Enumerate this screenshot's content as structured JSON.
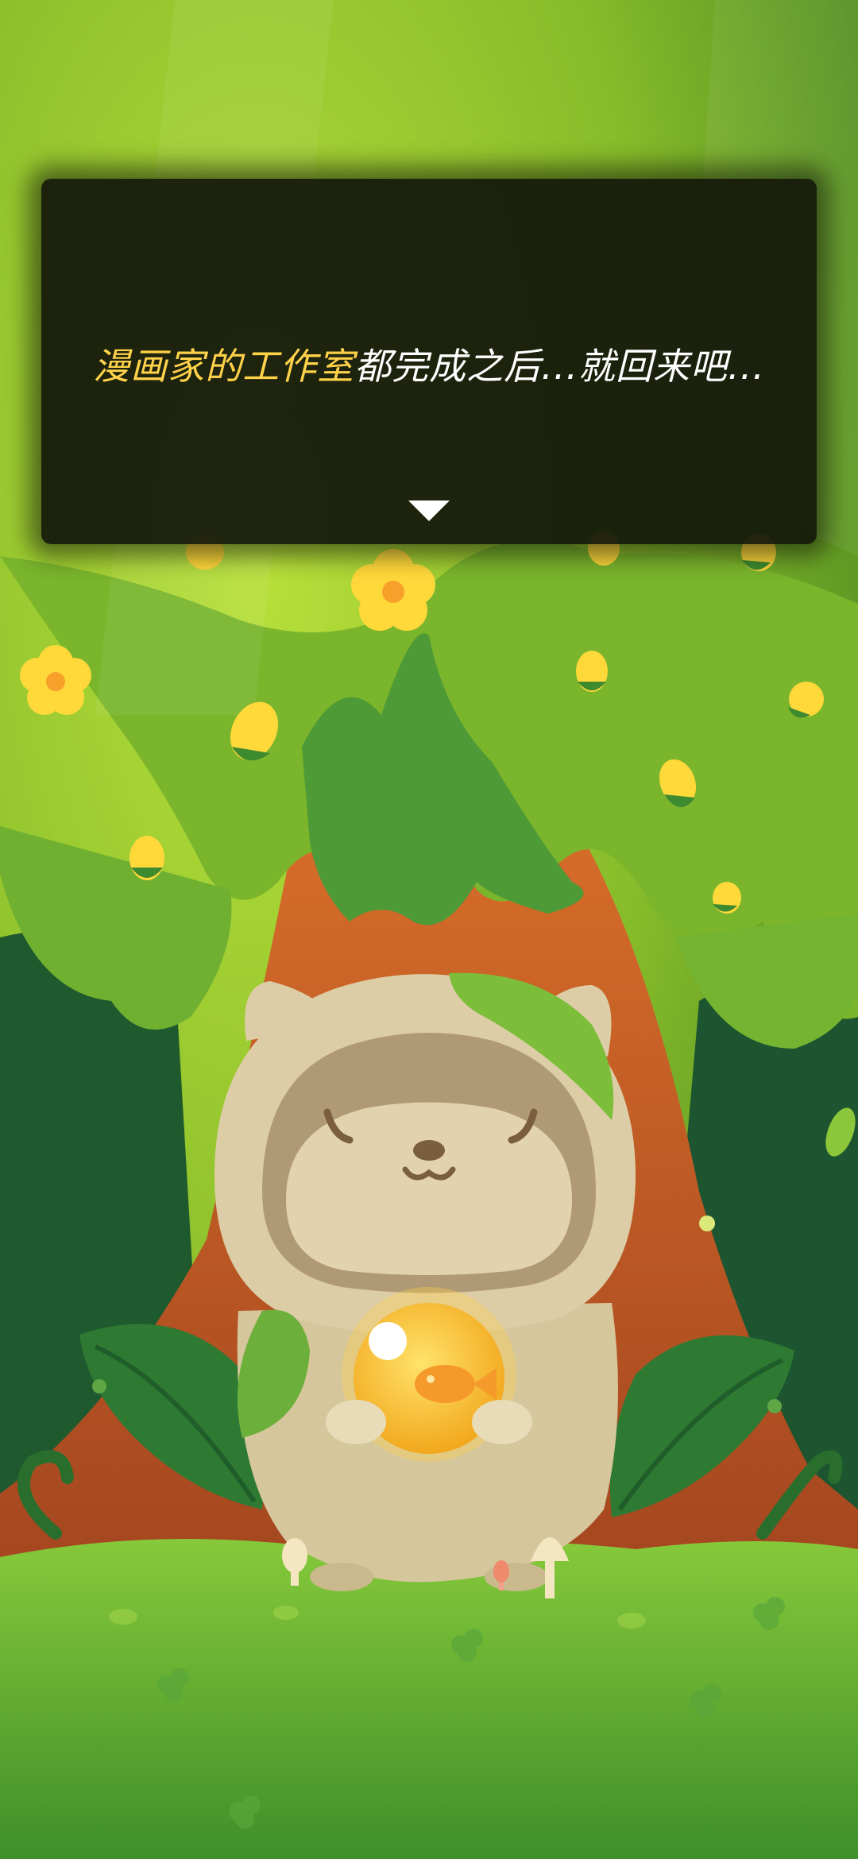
{
  "dialog": {
    "highlight_text": "漫画家的工作室",
    "body_text": "都完成之后...就回来吧...",
    "next_icon": "triangle-down-icon"
  },
  "colors": {
    "sky": "#8bbf2a",
    "canopy": "#7fb62c",
    "trunk": "#b65a26",
    "ground": "#6ab42e",
    "highlight": "#ffd24a",
    "creature_fur": "#dccda6",
    "orb": "#ffcc3a"
  }
}
